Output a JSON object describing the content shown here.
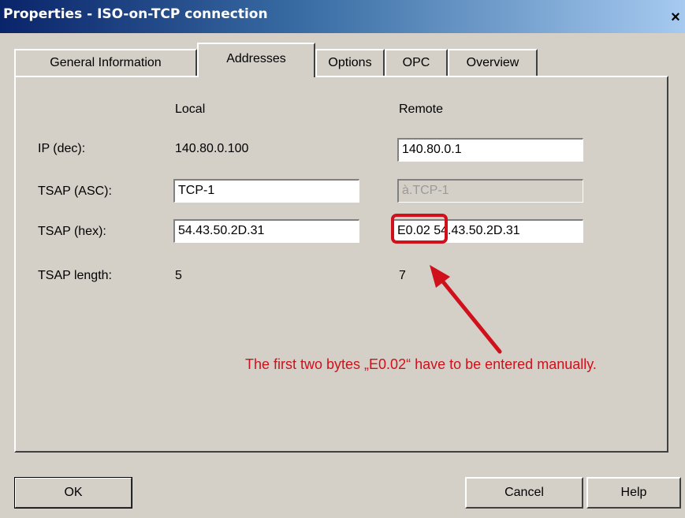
{
  "window": {
    "title": "Properties - ISO-on-TCP connection",
    "close_glyph": "×"
  },
  "tabs": [
    {
      "label": "General Information",
      "active": false
    },
    {
      "label": "Addresses",
      "active": true
    },
    {
      "label": "Options",
      "active": false
    },
    {
      "label": "OPC",
      "active": false
    },
    {
      "label": "Overview",
      "active": false
    }
  ],
  "columns": {
    "local": "Local",
    "remote": "Remote"
  },
  "rows": {
    "ip": {
      "label": "IP (dec):",
      "local": "140.80.0.100",
      "remote": "140.80.0.1"
    },
    "tsap_asc": {
      "label": "TSAP (ASC):",
      "local": "TCP-1",
      "remote": "à.TCP-1"
    },
    "tsap_hex": {
      "label": "TSAP (hex):",
      "local": "54.43.50.2D.31",
      "remote": "E0.02 54.43.50.2D.31"
    },
    "tsap_length": {
      "label": "TSAP length:",
      "local": "5",
      "remote": "7"
    }
  },
  "annotation": {
    "text": "The first two bytes „E0.02“ have to be entered manually.",
    "color": "#d0101a"
  },
  "buttons": {
    "ok": "OK",
    "cancel": "Cancel",
    "help": "Help"
  }
}
